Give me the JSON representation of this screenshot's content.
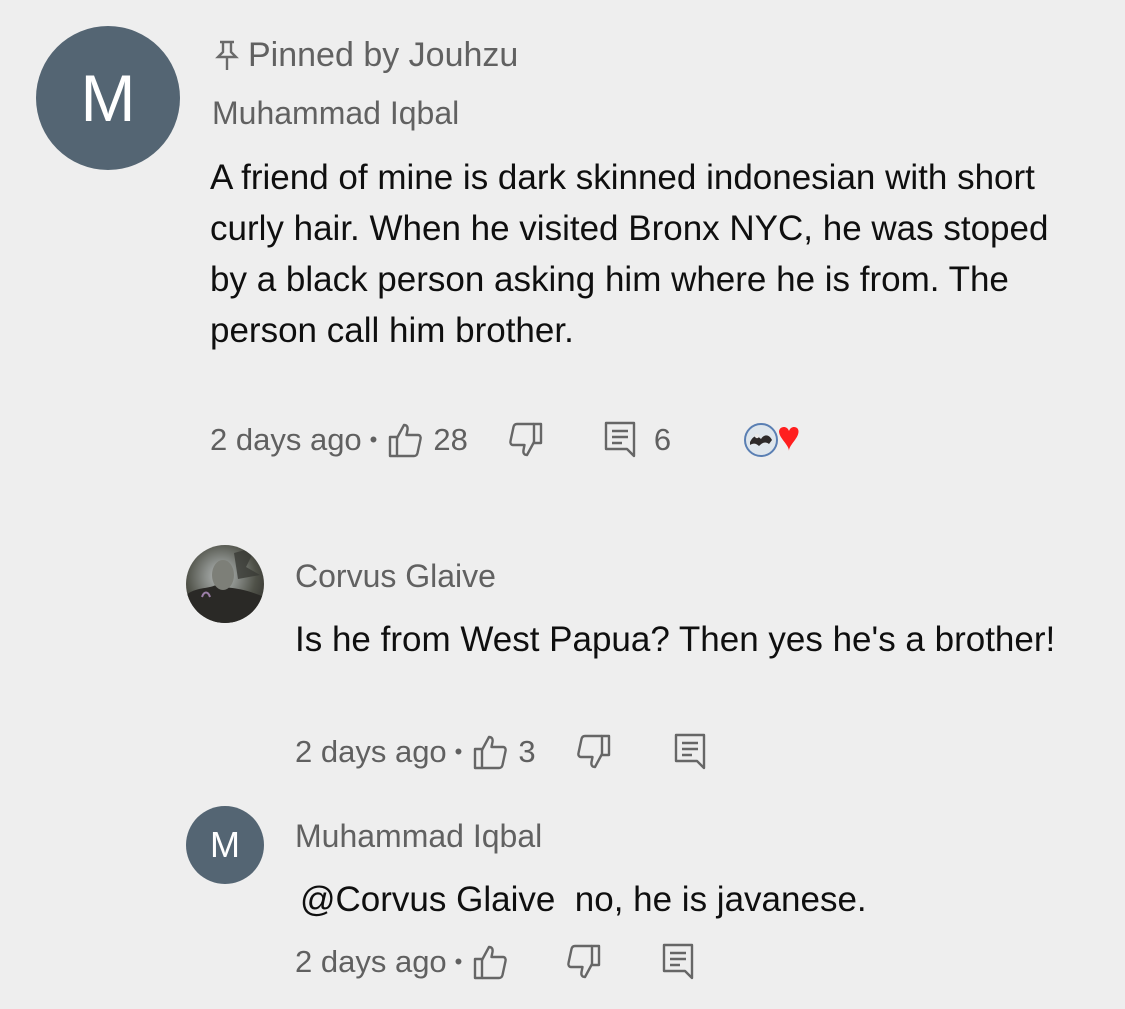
{
  "pinned": {
    "text": "Pinned by Jouhzu",
    "icon": "pin-icon"
  },
  "comment": {
    "avatar_letter": "M",
    "author": "Muhammad Iqbal",
    "body": "A friend of mine is dark skinned indonesian with short curly hair. When he visited Bronx NYC, he was stoped by a black person asking him where he is from. The person call him brother.",
    "time": "2 days ago",
    "likes": "28",
    "replies": "6"
  },
  "replies": [
    {
      "author": "Corvus Glaive",
      "body": "Is he from West Papua? Then yes he's a brother!",
      "time": "2 days ago",
      "likes": "3"
    },
    {
      "avatar_letter": "M",
      "author": "Muhammad Iqbal",
      "body": "@Corvus Glaive  no, he is javanese.",
      "time": "2 days ago"
    }
  ],
  "colors": {
    "avatar": "#546573",
    "heart": "#ff1f1f",
    "background": "#eeeeee",
    "muted": "#606060"
  }
}
